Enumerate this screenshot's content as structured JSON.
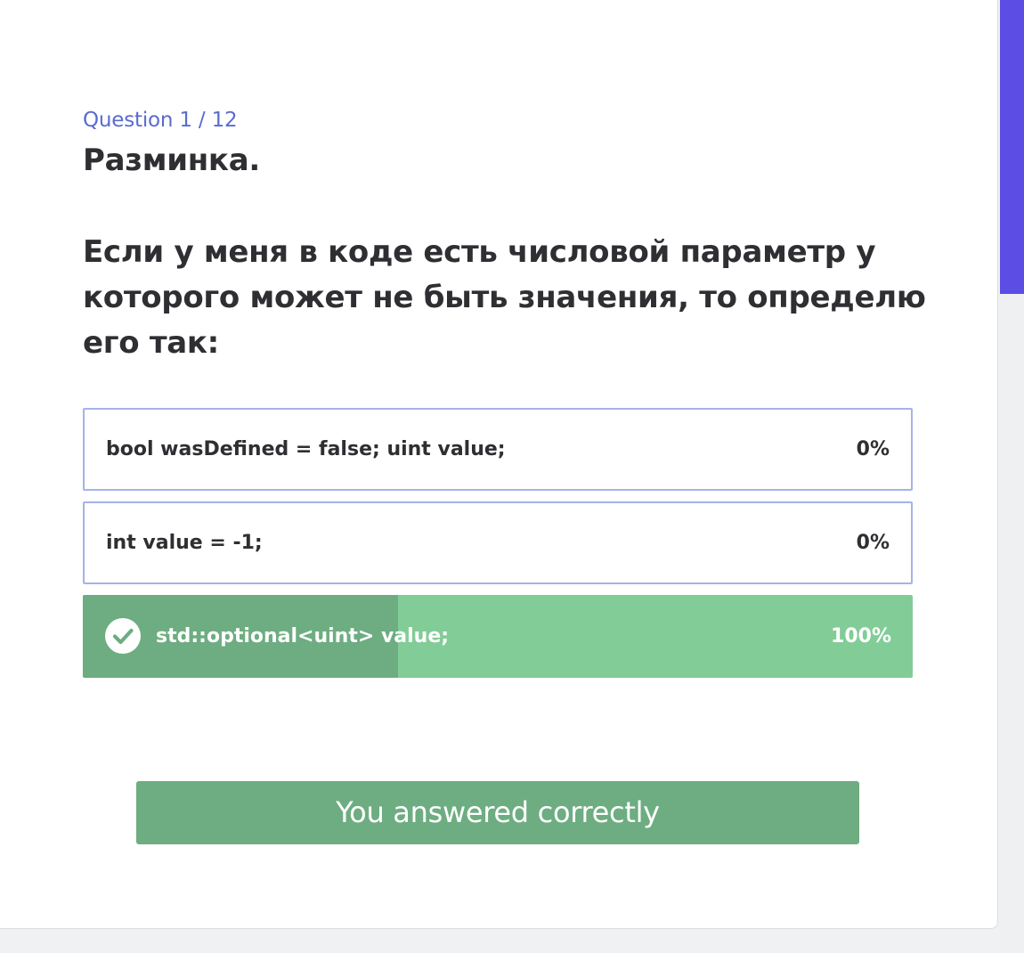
{
  "header": {
    "counter": "Question 1 / 12",
    "title": "Разминка."
  },
  "question": {
    "text": "Если у меня в коде есть числовой параметр у которого может не быть значения, то определю его так:"
  },
  "options": [
    {
      "label": "bool wasDefined = false; uint value;",
      "percent": "0%",
      "correct": false,
      "fill_fraction": 0
    },
    {
      "label": "int value = -1;",
      "percent": "0%",
      "correct": false,
      "fill_fraction": 0
    },
    {
      "label": "std::optional<uint> value;",
      "percent": "100%",
      "correct": true,
      "fill_fraction": 0.38
    }
  ],
  "result": {
    "label": "You answered correctly"
  },
  "colors": {
    "accent": "#5a6bd0",
    "scrollbar": "#5c4ee5",
    "correct_bg": "#82cc97",
    "correct_fill": "#6dad81",
    "option_border": "#a5b2ea"
  },
  "icons": {
    "correct_option": "check-circle-icon"
  }
}
